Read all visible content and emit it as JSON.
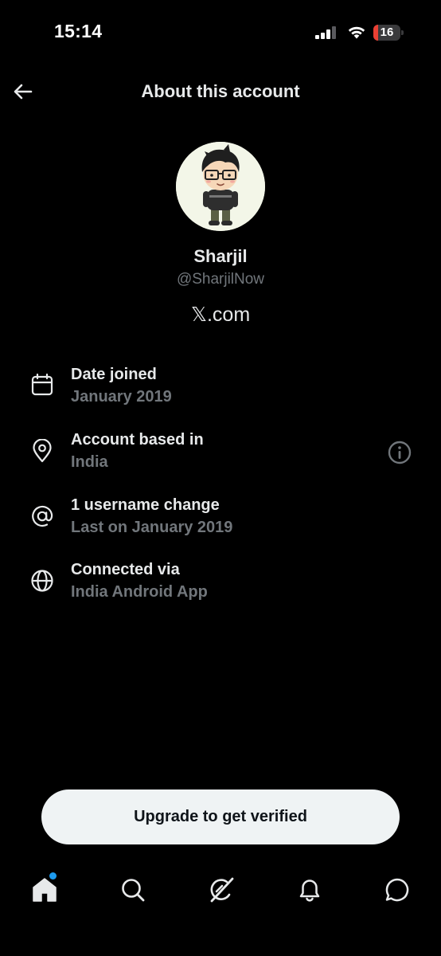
{
  "status_bar": {
    "time": "15:14",
    "battery_level": "16",
    "battery_color": "#eb4034"
  },
  "header": {
    "title": "About this account",
    "back_icon": "arrow-left-icon"
  },
  "profile": {
    "name": "Sharjil",
    "handle": "@SharjilNow",
    "site_prefix": "𝕏",
    "site_suffix": ".com"
  },
  "details": [
    {
      "icon": "calendar-icon",
      "title": "Date joined",
      "subtitle": "January 2019"
    },
    {
      "icon": "location-pin-icon",
      "title": "Account based in",
      "subtitle": "India"
    },
    {
      "icon": "at-sign-icon",
      "title": "1 username change",
      "subtitle": "Last on January 2019"
    },
    {
      "icon": "globe-icon",
      "title": "Connected via",
      "subtitle": "India Android App"
    }
  ],
  "cta": {
    "label": "Upgrade to get verified"
  },
  "nav": [
    {
      "icon": "home-icon",
      "active": true,
      "has_notification_dot": true
    },
    {
      "icon": "search-icon"
    },
    {
      "icon": "grok-icon"
    },
    {
      "icon": "bell-icon"
    },
    {
      "icon": "messages-icon"
    }
  ],
  "colors": {
    "background": "#000000",
    "text_primary": "#e7e9ea",
    "text_secondary": "#71767b",
    "accent": "#1d9bf0"
  }
}
